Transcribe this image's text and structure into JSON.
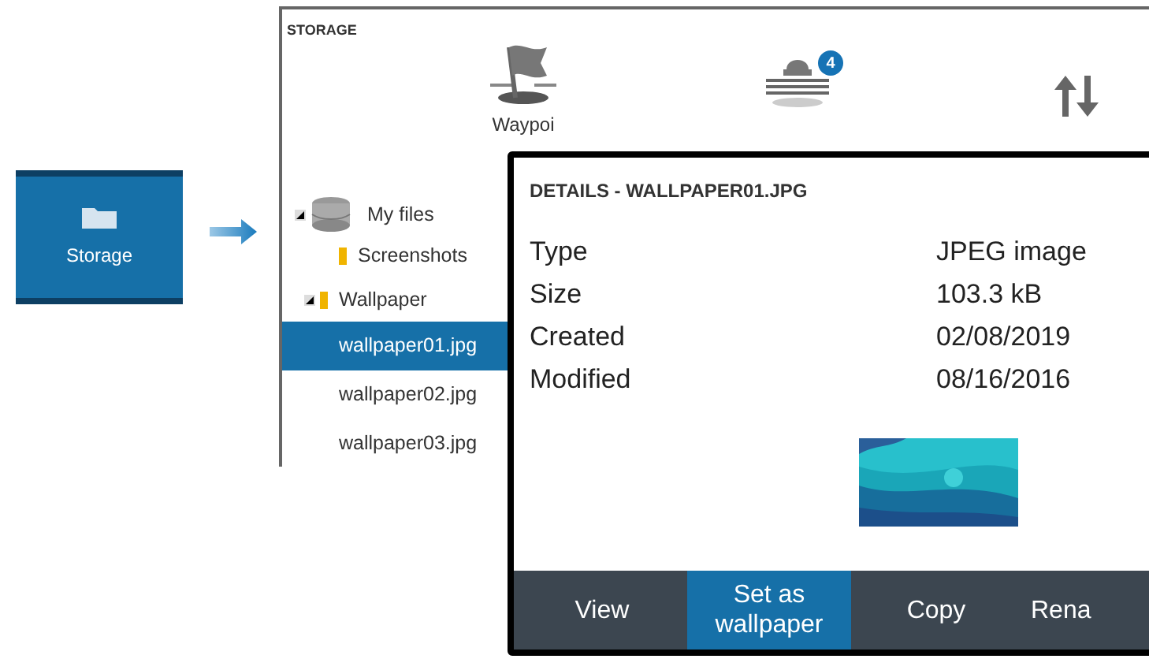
{
  "launcher_tile": {
    "label": "Storage"
  },
  "storage_panel": {
    "title": "STORAGE",
    "categories": [
      {
        "kind": "flag",
        "label": "Waypoi"
      },
      {
        "kind": "boat",
        "badge": "4"
      },
      {
        "kind": "transfer"
      }
    ],
    "tree": [
      {
        "kind": "drive",
        "label": "My files",
        "selected": false,
        "children": [
          {
            "kind": "folder",
            "label": "Screenshots",
            "selected": false
          },
          {
            "kind": "folder",
            "label": "Wallpaper",
            "selected": false,
            "children": [
              {
                "kind": "file",
                "label": "wallpaper01.jpg",
                "selected": true
              },
              {
                "kind": "file",
                "label": "wallpaper02.jpg",
                "selected": false
              },
              {
                "kind": "file",
                "label": "wallpaper03.jpg",
                "selected": false
              }
            ]
          }
        ]
      }
    ]
  },
  "details_dialog": {
    "title": "DETAILS - WALLPAPER01.JPG",
    "properties": [
      {
        "label": "Type",
        "value": "JPEG image"
      },
      {
        "label": "Size",
        "value": "103.3 kB"
      },
      {
        "label": "Created",
        "value": "02/08/2019"
      },
      {
        "label": "Modified",
        "value": "08/16/2016"
      }
    ],
    "buttons": [
      {
        "label": "View",
        "selected": false
      },
      {
        "label": "Set as wallpaper",
        "selected": true
      },
      {
        "label": "Copy",
        "selected": false
      },
      {
        "label": "Rena",
        "selected": false
      }
    ]
  }
}
